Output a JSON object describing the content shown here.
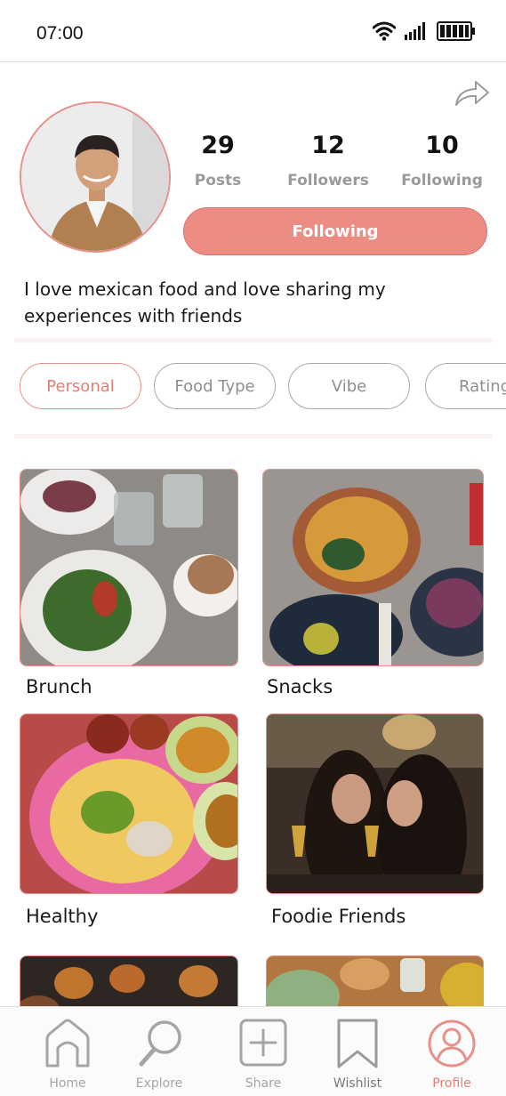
{
  "status_bar": {
    "time": "07:00"
  },
  "profile": {
    "stats": [
      {
        "value": "29",
        "label": "Posts"
      },
      {
        "value": "12",
        "label": "Followers"
      },
      {
        "value": "10",
        "label": "Following"
      }
    ],
    "follow_button_label": "Following",
    "bio": "I love mexican food and love sharing my experiences with friends"
  },
  "filters": [
    {
      "label": "Personal",
      "active": true
    },
    {
      "label": "Food Type",
      "active": false
    },
    {
      "label": "Vibe",
      "active": false
    },
    {
      "label": "Rating",
      "active": false
    }
  ],
  "collections": [
    {
      "label": "Brunch"
    },
    {
      "label": "Snacks"
    },
    {
      "label": "Healthy"
    },
    {
      "label": "Foodie Friends"
    }
  ],
  "bottom_nav": [
    {
      "label": "Home",
      "icon": "home-icon"
    },
    {
      "label": "Explore",
      "icon": "search-icon"
    },
    {
      "label": "Share",
      "icon": "plus-square-icon"
    },
    {
      "label": "Wishlist",
      "icon": "bookmark-icon"
    },
    {
      "label": "Profile",
      "icon": "user-circle-icon",
      "active": true
    }
  ],
  "colors": {
    "accent": "#ed8c82",
    "accent_border": "#e8908a",
    "muted": "#9a9a9a"
  }
}
